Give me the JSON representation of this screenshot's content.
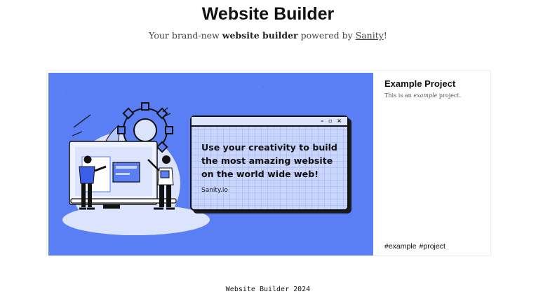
{
  "header": {
    "title": "Website Builder",
    "tagline_prefix": "Your brand-new ",
    "tagline_bold": "website builder",
    "tagline_middle": " powered by ",
    "tagline_link": "Sanity",
    "tagline_suffix": "!"
  },
  "project": {
    "title": "Example Project",
    "desc_prefix": "This is an ",
    "desc_emph": "example",
    "desc_suffix": " project.",
    "tags": [
      "#example",
      "#project"
    ],
    "image": {
      "headline": "Use your creativity to build the most amazing website on the world wide web!",
      "brand": "Sanity.io",
      "window_controls": "– ▫ ×"
    }
  },
  "footer": {
    "text": "Website Builder 2024"
  },
  "colors": {
    "hero_blue": "#5a7ef3",
    "window_fill": "#c9d5fb"
  }
}
